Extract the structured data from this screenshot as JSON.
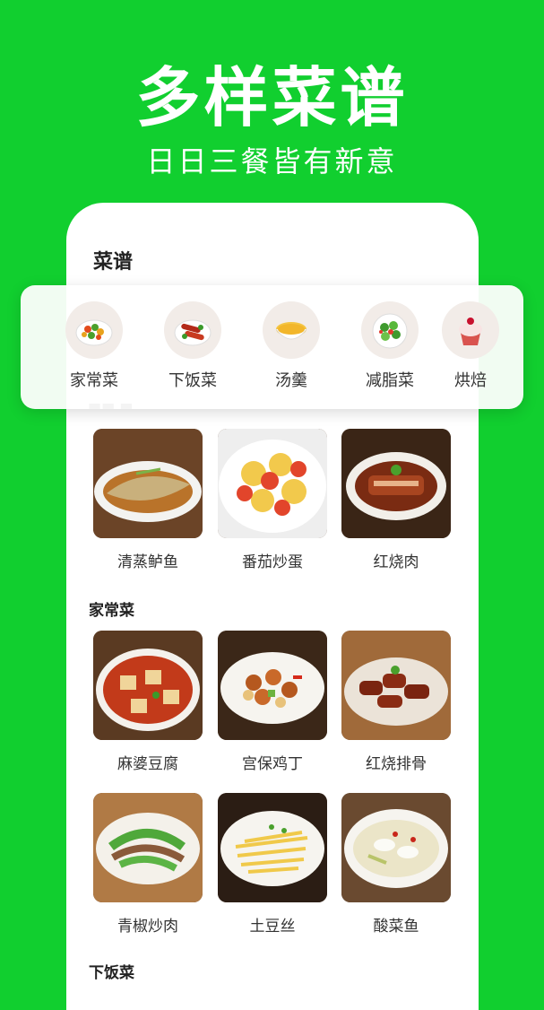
{
  "hero": {
    "title": "多样菜谱",
    "subtitle": "日日三餐皆有新意"
  },
  "phone": {
    "title": "菜谱"
  },
  "categories": [
    {
      "label": "家常菜",
      "icon": "mixed-vegetables-icon"
    },
    {
      "label": "下饭菜",
      "icon": "sausage-dish-icon"
    },
    {
      "label": "汤羹",
      "icon": "soup-bowl-icon"
    },
    {
      "label": "减脂菜",
      "icon": "salad-icon"
    },
    {
      "label": "烘焙",
      "icon": "cupcake-icon"
    }
  ],
  "sections": [
    {
      "title": "",
      "dishes": [
        "清蒸鲈鱼",
        "番茄炒蛋",
        "红烧肉"
      ]
    },
    {
      "title": "家常菜",
      "dishes": [
        "麻婆豆腐",
        "宫保鸡丁",
        "红烧排骨",
        "青椒炒肉",
        "土豆丝",
        "酸菜鱼"
      ]
    },
    {
      "title": "下饭菜",
      "dishes": []
    }
  ],
  "colors": {
    "brand": "#11cf2f",
    "card": "#ffffff",
    "text": "#333333"
  }
}
